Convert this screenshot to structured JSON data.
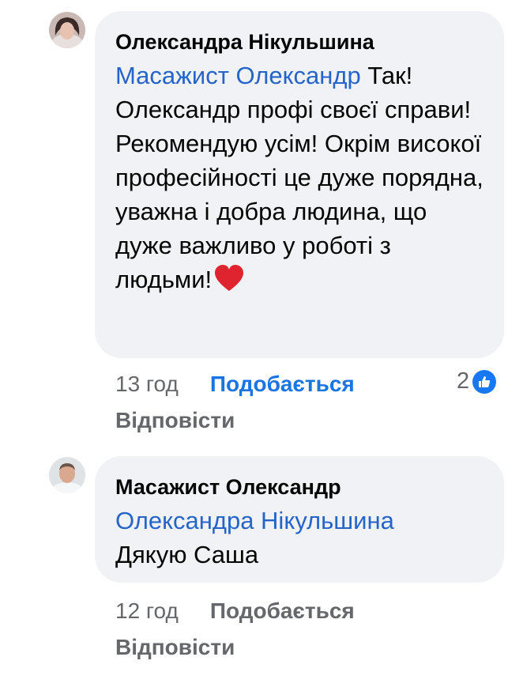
{
  "comments": [
    {
      "author": "Олександра Нікульшина",
      "mention": "Масажист Олександр",
      "text": " Так! Олександр профі своєї справи! Рекомендую усім! Окрім високої професійності це дуже порядна, уважна і добра людина, що дуже важливо у роботі з людьми!",
      "emoji": "red-heart",
      "time": "13 год",
      "like_label": "Подобається",
      "reply_label": "Відповісти",
      "reaction_count": "2",
      "like_active": true
    },
    {
      "author": "Масажист Олександр",
      "mention": "Олександра Нікульшина",
      "text": "Дякую Саша",
      "time": "12 год",
      "like_label": "Подобається",
      "reply_label": "Відповісти"
    }
  ],
  "colors": {
    "mention": "#2564c8",
    "like_active": "#1b74e4",
    "bubble": "#f0f2f5",
    "meta": "#65676b"
  }
}
